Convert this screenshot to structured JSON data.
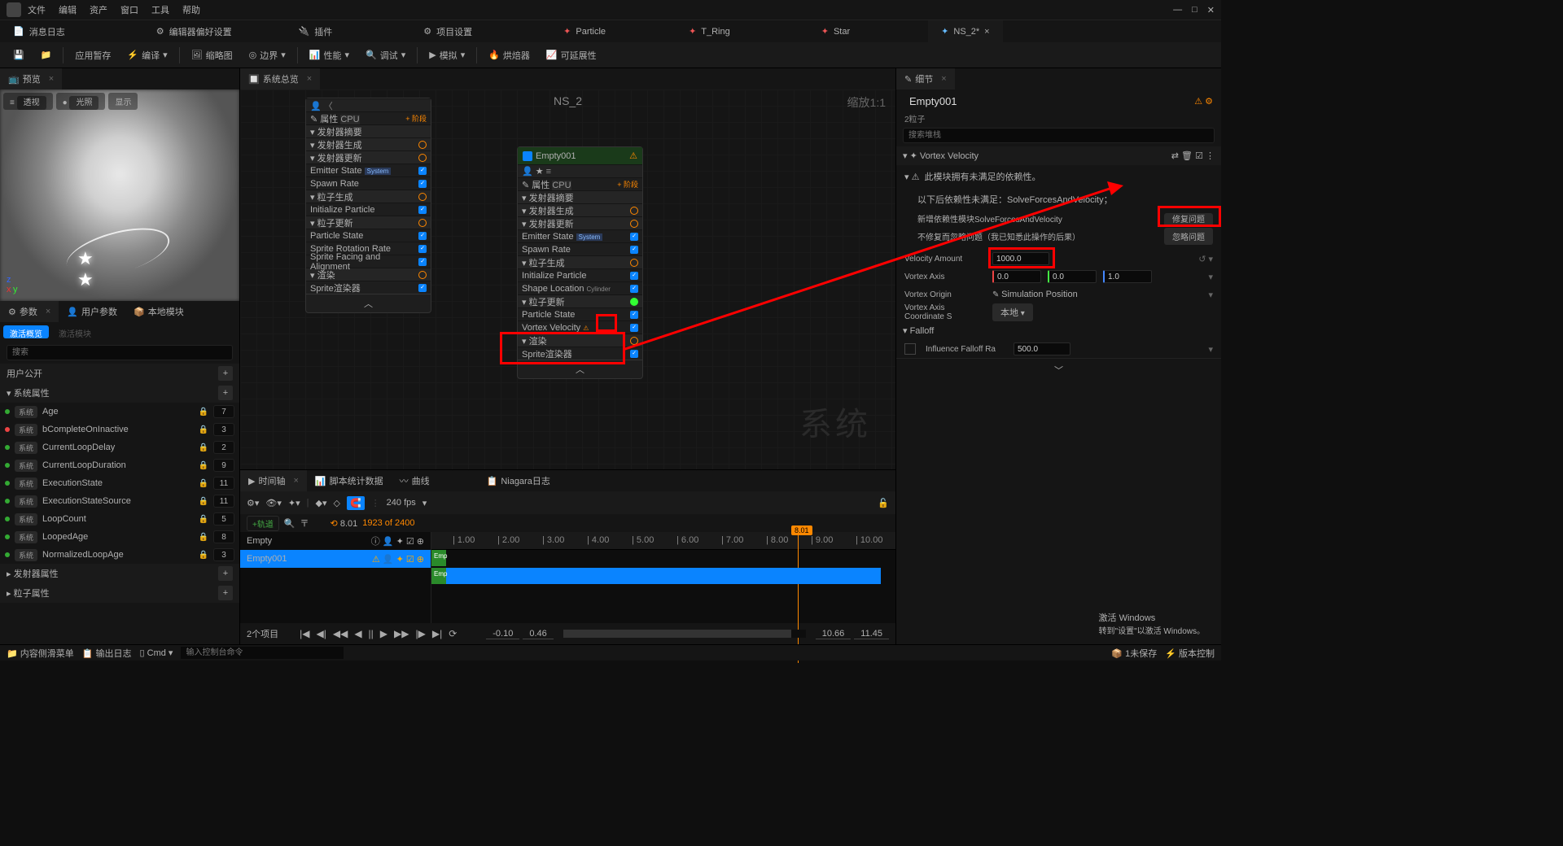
{
  "menu": [
    "文件",
    "编辑",
    "资产",
    "窗口",
    "工具",
    "帮助"
  ],
  "tabs": [
    {
      "label": "消息日志",
      "icon": ""
    },
    {
      "label": "编辑器偏好设置",
      "icon": ""
    },
    {
      "label": "插件",
      "icon": ""
    },
    {
      "label": "项目设置",
      "icon": ""
    },
    {
      "label": "Particle",
      "color": "#e55"
    },
    {
      "label": "T_Ring",
      "color": "#e55"
    },
    {
      "label": "Star",
      "color": "#e55"
    },
    {
      "label": "NS_2*",
      "color": "#6bf",
      "active": true
    }
  ],
  "toolbar": {
    "save": "",
    "apply": "应用暂存",
    "compile": "编译",
    "thumb": "缩略图",
    "bound": "边界",
    "perf": "性能",
    "debug": "调试",
    "sim": "模拟",
    "bake": "烘焙器",
    "ext": "可延展性"
  },
  "preview": {
    "tab": "预览",
    "btns": [
      "透视",
      "光照",
      "显示"
    ]
  },
  "systemOverview": "系统总览",
  "graphTitle": "NS_2",
  "zoom": "缩放1:1",
  "watermark": "系统",
  "node1": {
    "subhead": "发射器摘要",
    "rows": [
      {
        "t": "sect",
        "l": "发射器生成"
      },
      {
        "t": "sect",
        "l": "发射器更新"
      },
      {
        "t": "chk",
        "l": "Emitter State",
        "tag": "System"
      },
      {
        "t": "chk",
        "l": "Spawn Rate"
      },
      {
        "t": "sect",
        "l": "粒子生成"
      },
      {
        "t": "chk",
        "l": "Initialize Particle"
      },
      {
        "t": "sect",
        "l": "粒子更新"
      },
      {
        "t": "chk",
        "l": "Particle State"
      },
      {
        "t": "chk",
        "l": "Sprite Rotation Rate"
      },
      {
        "t": "chk",
        "l": "Sprite Facing and Alignment"
      },
      {
        "t": "sect",
        "l": "渲染"
      },
      {
        "t": "chk",
        "l": "Sprite渲染器"
      }
    ],
    "attr": "属性",
    "cpu": "CPU",
    "stage": "+ 阶段"
  },
  "node2": {
    "title": "Empty001",
    "subhead": "发射器摘要",
    "attr": "属性",
    "cpu": "CPU",
    "stage": "+ 阶段",
    "rows": [
      {
        "t": "sect",
        "l": "发射器生成"
      },
      {
        "t": "sect",
        "l": "发射器更新"
      },
      {
        "t": "chk",
        "l": "Emitter State",
        "tag": "System"
      },
      {
        "t": "chk",
        "l": "Spawn Rate"
      },
      {
        "t": "sect",
        "l": "粒子生成"
      },
      {
        "t": "chk",
        "l": "Initialize Particle"
      },
      {
        "t": "chk",
        "l": "Shape Location",
        "tag2": "Cylinder"
      },
      {
        "t": "sect",
        "l": "粒子更新",
        "hl": true
      },
      {
        "t": "chk",
        "l": "Particle State"
      },
      {
        "t": "chk",
        "l": "Vortex Velocity",
        "hl": true,
        "warn": true
      },
      {
        "t": "sect",
        "l": "渲染"
      },
      {
        "t": "chk",
        "l": "Sprite渲染器"
      }
    ]
  },
  "params": {
    "tab": "参数",
    "userparam": "用户参数",
    "local": "本地模块",
    "active": "激活概览",
    "inactive": "激活模块",
    "search": "搜索",
    "cat1": "用户公开",
    "cat2": "系统属性",
    "cat3": "发射器属性",
    "cat4": "粒子属性",
    "props": [
      {
        "tag": "系统",
        "name": "Age",
        "cnt": "7"
      },
      {
        "tag": "系统",
        "name": "bCompleteOnInactive",
        "cnt": "3",
        "warn": true
      },
      {
        "tag": "系统",
        "name": "CurrentLoopDelay",
        "cnt": "2"
      },
      {
        "tag": "系统",
        "name": "CurrentLoopDuration",
        "cnt": "9"
      },
      {
        "tag": "系统",
        "name": "ExecutionState",
        "cnt": "11"
      },
      {
        "tag": "系统",
        "name": "ExecutionStateSource",
        "cnt": "11"
      },
      {
        "tag": "系统",
        "name": "LoopCount",
        "cnt": "5"
      },
      {
        "tag": "系统",
        "name": "LoopedAge",
        "cnt": "8"
      },
      {
        "tag": "系统",
        "name": "NormalizedLoopAge",
        "cnt": "3"
      }
    ]
  },
  "timeline": {
    "tab": "时间轴",
    "stats": "脚本统计数据",
    "curve": "曲线",
    "log": "Niagara日志",
    "addtrack": "+轨道",
    "fps": "240 fps",
    "time": "8.01",
    "frames": "1923 of 2400",
    "rows": [
      {
        "name": "Empty",
        "short": "Emp"
      },
      {
        "name": "Empty001",
        "short": "Emp",
        "sel": true
      }
    ],
    "ticks": [
      "1.00",
      "2.00",
      "3.00",
      "4.00",
      "5.00",
      "6.00",
      "7.00",
      "8.00",
      "9.00",
      "10.00"
    ],
    "marker": "8.01",
    "items": "2个项目",
    "t_left": "-0.10",
    "t_now": "0.46",
    "t_r1": "10.66",
    "t_r2": "11.45"
  },
  "details": {
    "tab": "细节",
    "title": "Empty001",
    "subtitle": "2粒子",
    "search": "搜索堆栈",
    "section": "Vortex Velocity",
    "warn1": "此模块拥有未满足的依赖性。",
    "warn2": "以下后依赖性未满足：SolveForcesAndVelocity；",
    "warn3": "新增依赖性模块SolveForcesAndVelocity",
    "warn4": "不修复而忽略问题（我已知悉此操作的后果）",
    "fix": "修复问题",
    "ignore": "忽略问题",
    "p_vel": "Velocity Amount",
    "v_vel": "1000.0",
    "p_axis": "Vortex Axis",
    "ax": [
      "0.0",
      "0.0",
      "1.0"
    ],
    "p_origin": "Vortex Origin",
    "v_origin": "Simulation Position",
    "p_coord": "Vortex Axis Coordinate S",
    "v_coord": "本地",
    "p_falloff": "Falloff",
    "p_inf": "Influence Falloff Ra",
    "v_inf": "500.0"
  },
  "status": {
    "content": "内容侧滑菜单",
    "output": "输出日志",
    "cmd": "Cmd",
    "cmdph": "输入控制台命令",
    "unsaved": "1未保存",
    "rev": "版本控制"
  },
  "winact": {
    "l1": "激活 Windows",
    "l2": "转到\"设置\"以激活 Windows。"
  }
}
